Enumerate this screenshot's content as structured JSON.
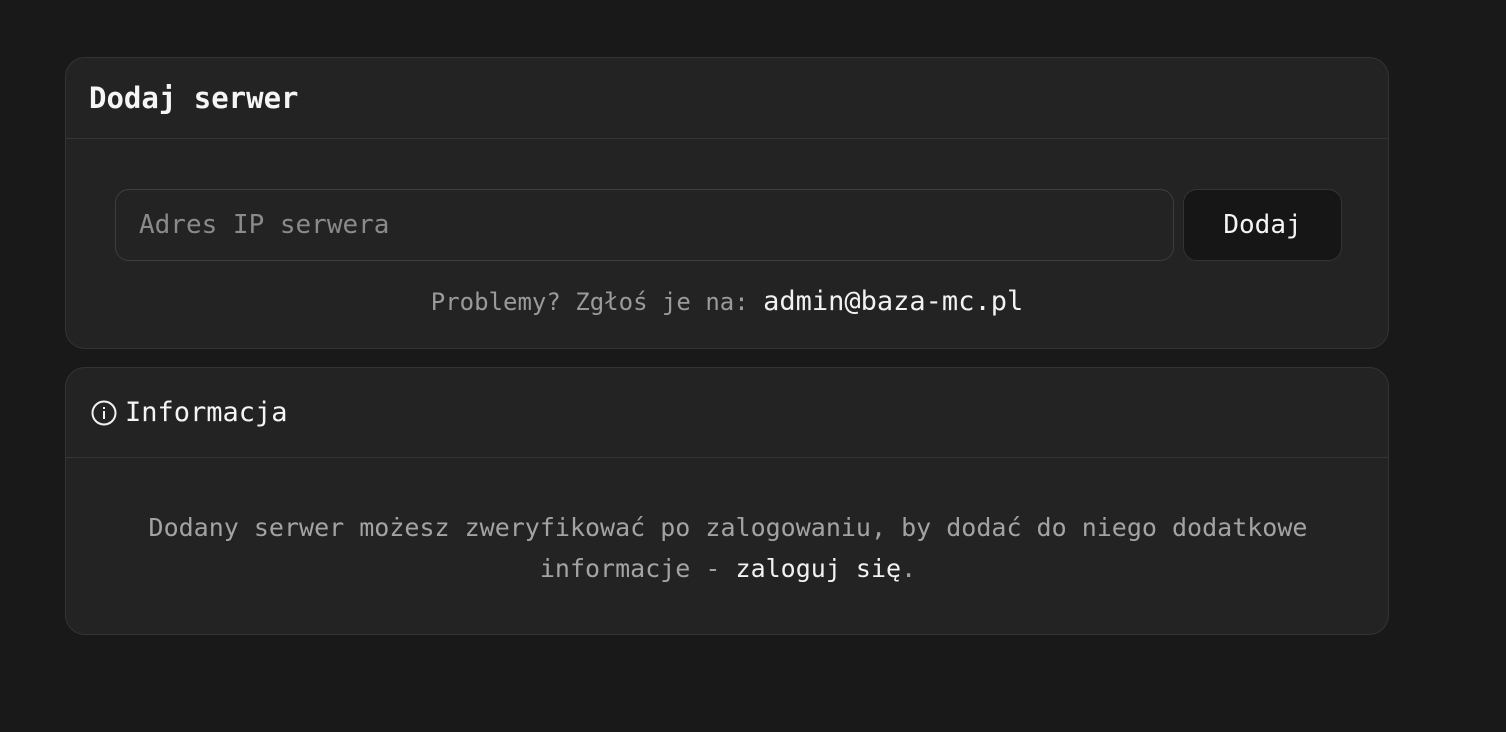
{
  "add_server": {
    "title": "Dodaj serwer",
    "input_placeholder": "Adres IP serwera",
    "input_value": "",
    "button_label": "Dodaj",
    "problems_text": "Problemy? Zgłoś je na: ",
    "problems_email": "admin@baza-mc.pl"
  },
  "info": {
    "icon": "info-circle-icon",
    "title": "Informacja",
    "body_text": "Dodany serwer możesz zweryfikować po zalogowaniu, by dodać do niego dodatkowe informacje - ",
    "login_link": "zaloguj się",
    "body_end": "."
  }
}
